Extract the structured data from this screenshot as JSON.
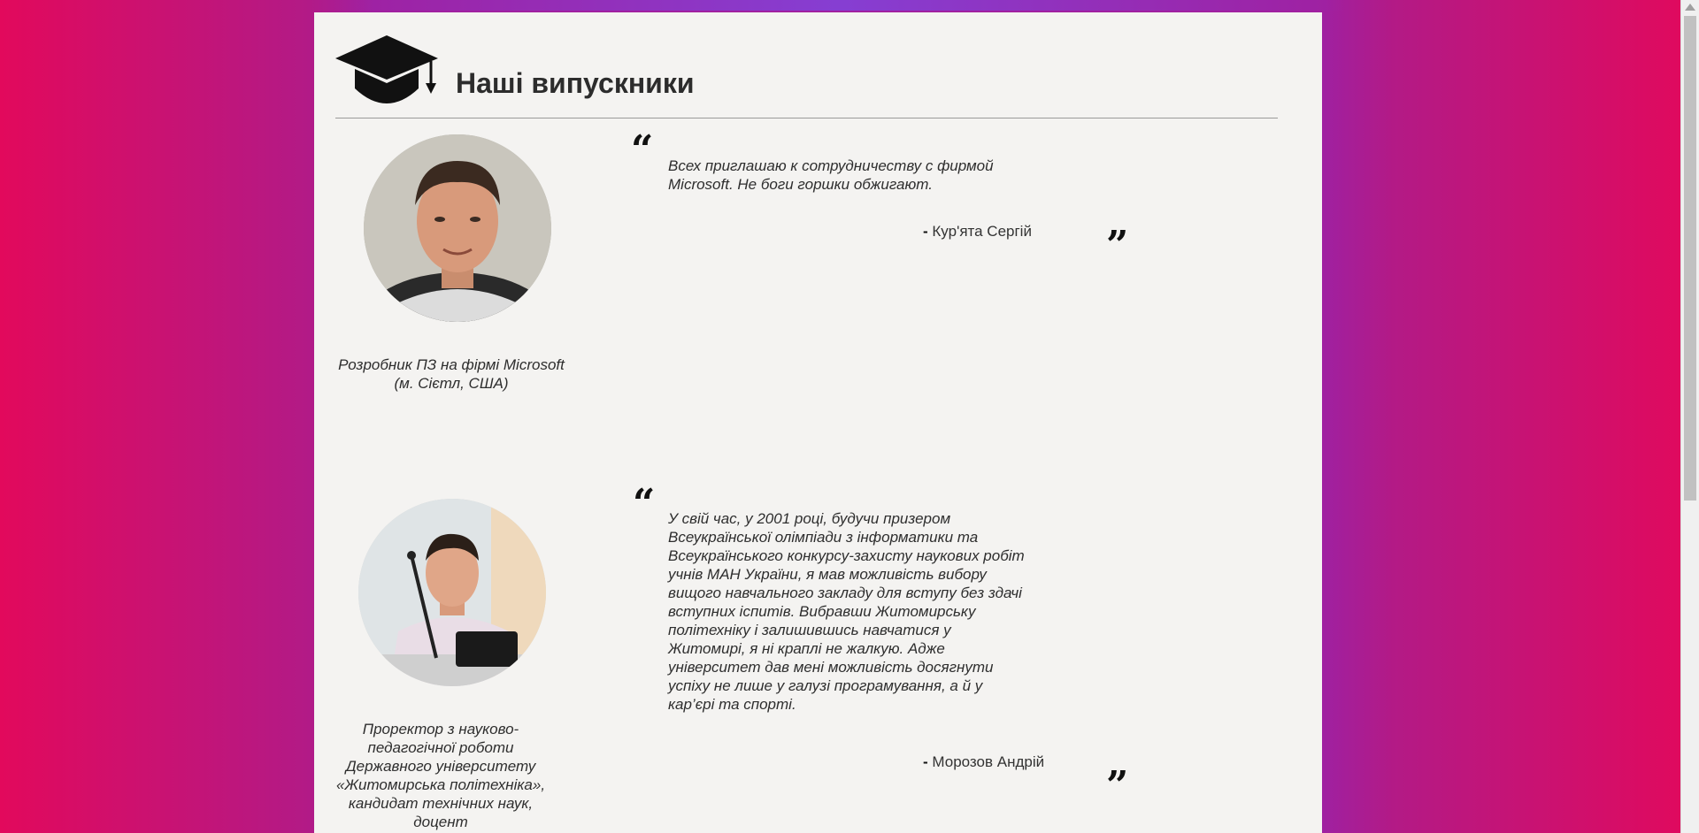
{
  "header": {
    "title": "Наші випускники",
    "icon": "graduation-cap-icon"
  },
  "graduates": [
    {
      "quote": "Всех приглашаю к сотрудничеству с фирмой Microsoft. Не боги горшки обжигают.",
      "author": "Кур'ята Сергій",
      "role": "Розробник ПЗ на фірмі Microsoft (м. Сієтл, США)"
    },
    {
      "quote": "У свій час, у 2001 році, будучи призером Всеукраїнської олімпіади з інформатики та Всеукраїнського конкурсу-захисту наукових робіт учнів МАН України, я мав можливість вибору вищого навчального закладу для вступу без здачі вступних іспитів. Вибравши Житомирську політехніку і залишившись навчатися у Житомирі, я ні краплі не жалкую. Адже університет дав мені можливість досягнути успіху не лише у галузі програмування, а й у кар’єрі та спорті.",
      "author": "Морозов Андрій",
      "role": "Проректор з науково-педагогічної роботи Державного університету «Житомирська політехніка», кандидат технічних наук, доцент"
    }
  ],
  "marks": {
    "open_quote": "“",
    "close_quote": "”",
    "dash": "-"
  }
}
